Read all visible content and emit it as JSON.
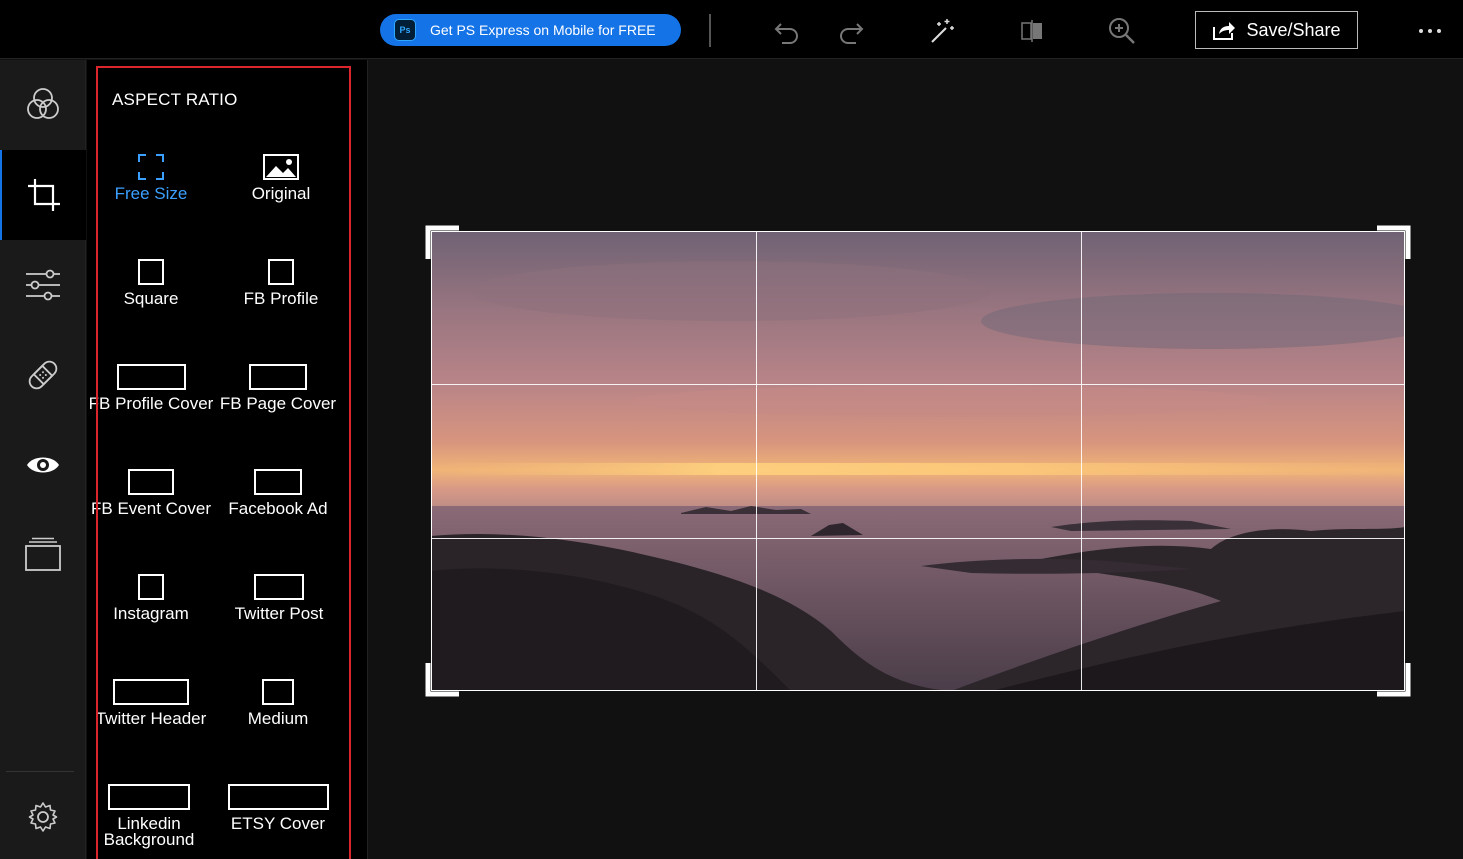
{
  "toolbar": {
    "promo_label": "Get PS Express on Mobile for FREE",
    "promo_badge": "Ps",
    "save_label": "Save/Share"
  },
  "panel": {
    "title": "ASPECT RATIO",
    "ratios": [
      {
        "label": "Free Size",
        "icon": "free-size-icon",
        "active": true
      },
      {
        "label": "Original",
        "icon": "image-icon"
      },
      {
        "label": "Square",
        "icon": "square-ratio-icon"
      },
      {
        "label": "FB Profile",
        "icon": "square-ratio-icon"
      },
      {
        "label": "FB Profile Cover",
        "icon": "wide-ratio-icon"
      },
      {
        "label": "FB Page Cover",
        "icon": "wide-ratio-icon"
      },
      {
        "label": "FB Event Cover",
        "icon": "wide-ratio-icon"
      },
      {
        "label": "Facebook Ad",
        "icon": "wide-ratio-icon"
      },
      {
        "label": "Instagram",
        "icon": "square-ratio-icon"
      },
      {
        "label": "Twitter Post",
        "icon": "wide-ratio-icon"
      },
      {
        "label": "Twitter Header",
        "icon": "wide-ratio-icon"
      },
      {
        "label": "Medium",
        "icon": "square-ratio-icon"
      },
      {
        "label": "Linkedin Background",
        "icon": "wide-ratio-icon"
      },
      {
        "label": "ETSY Cover",
        "icon": "wide-ratio-icon"
      }
    ]
  },
  "rail": [
    {
      "name": "looks-icon"
    },
    {
      "name": "crop-icon",
      "active": true
    },
    {
      "name": "adjustments-icon"
    },
    {
      "name": "healing-icon"
    },
    {
      "name": "red-eye-icon"
    },
    {
      "name": "borders-icon"
    },
    {
      "name": "settings-icon"
    }
  ],
  "colors": {
    "accent": "#1473e6",
    "active_label": "#3ba0ff",
    "highlight": "#d9252b"
  }
}
